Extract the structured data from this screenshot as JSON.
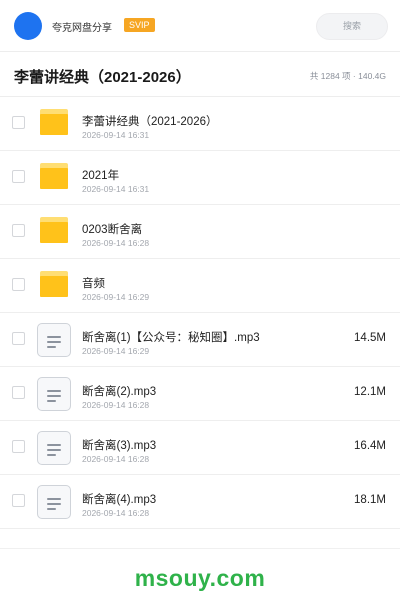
{
  "header": {
    "brand": "夸克网盘分享",
    "badge": "SVIP",
    "search_label": "搜索"
  },
  "folder": {
    "title": "李蕾讲经典（2021-2026）",
    "meta": "共 1284 项 · 140.4G"
  },
  "files": [
    {
      "type": "folder",
      "name": "李蕾讲经典（2021-2026）",
      "date": "2026-09-14 16:31",
      "size": ""
    },
    {
      "type": "folder",
      "name": "2021年",
      "date": "2026-09-14 16:31",
      "size": ""
    },
    {
      "type": "folder",
      "name": "0203断舍离",
      "date": "2026-09-14 16:28",
      "size": ""
    },
    {
      "type": "folder",
      "name": "音频",
      "date": "2026-09-14 16:29",
      "size": ""
    },
    {
      "type": "file",
      "name": "断舍离(1)【公众号：秘知圈】.mp3",
      "date": "2026-09-14 16:29",
      "size": "14.5M"
    },
    {
      "type": "file",
      "name": "断舍离(2).mp3",
      "date": "2026-09-14 16:28",
      "size": "12.1M"
    },
    {
      "type": "file",
      "name": "断舍离(3).mp3",
      "date": "2026-09-14 16:28",
      "size": "16.4M"
    },
    {
      "type": "file",
      "name": "断舍离(4).mp3",
      "date": "2026-09-14 16:28",
      "size": "18.1M"
    }
  ],
  "watermark": "msouy.com",
  "colors": {
    "accent": "#1e73f0",
    "folder": "#ffc21a",
    "badge": "#f6a623",
    "watermark": "#2fb24a"
  },
  "icons": {
    "folder": "folder-icon",
    "file": "audio-file-icon"
  }
}
